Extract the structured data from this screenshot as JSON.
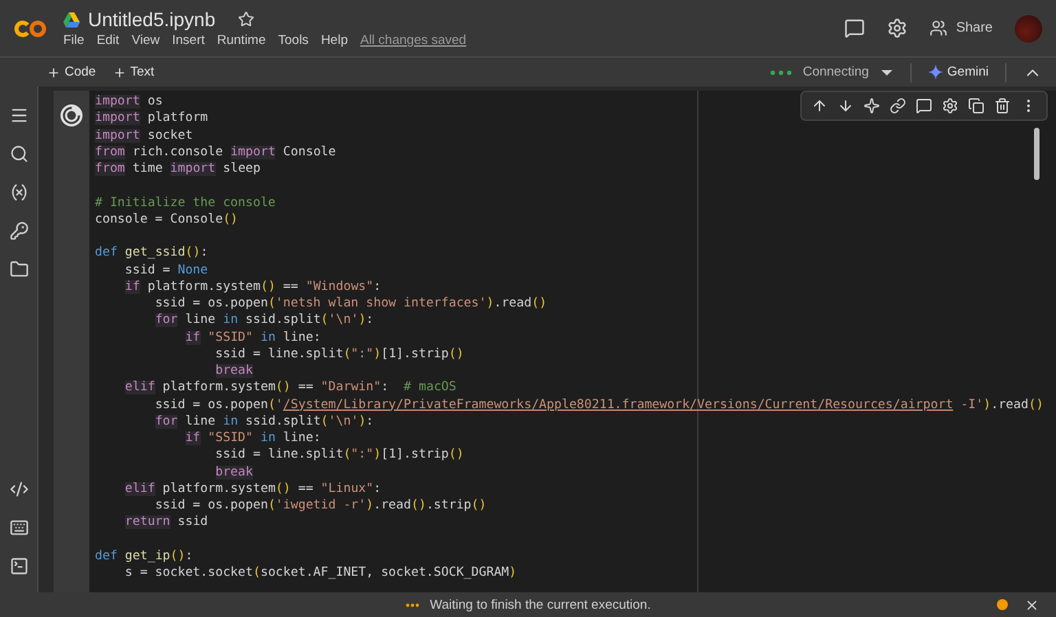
{
  "header": {
    "title": "Untitled5.ipynb",
    "menu": [
      "File",
      "Edit",
      "View",
      "Insert",
      "Runtime",
      "Tools",
      "Help"
    ],
    "save_status": "All changes saved",
    "share": "Share"
  },
  "toolbar": {
    "add_buttons": [
      "Code",
      "Text"
    ],
    "runtime_status": "Connecting",
    "gemini": "Gemini"
  },
  "code_lines": [
    {
      "kind": "code",
      "tokens": [
        {
          "text": "import",
          "kind": "kw"
        },
        {
          "text": " os",
          "kind": "p"
        }
      ]
    },
    {
      "kind": "code",
      "tokens": [
        {
          "text": "import",
          "kind": "kw"
        },
        {
          "text": " platform",
          "kind": "p"
        }
      ]
    },
    {
      "kind": "code",
      "tokens": [
        {
          "text": "import",
          "kind": "kw"
        },
        {
          "text": " socket",
          "kind": "p"
        }
      ]
    },
    {
      "kind": "code",
      "tokens": [
        {
          "text": "from",
          "kind": "kw"
        },
        {
          "text": " rich.console",
          "kind": "p"
        },
        {
          "text": " import",
          "kind": "kw"
        },
        {
          "text": " Console",
          "kind": "p"
        }
      ]
    },
    {
      "kind": "code",
      "tokens": [
        {
          "text": "from",
          "kind": "kw"
        },
        {
          "text": " time",
          "kind": "p"
        },
        {
          "text": " import",
          "kind": "kw"
        },
        {
          "text": " sleep",
          "kind": "p"
        }
      ]
    },
    {
      "kind": "blank"
    },
    {
      "kind": "code",
      "tokens": [
        {
          "text": "# Initialize the console",
          "kind": "cmt"
        }
      ]
    },
    {
      "kind": "code",
      "tokens": [
        {
          "text": "console = Console",
          "kind": "p"
        },
        {
          "text": "()",
          "kind": "par"
        }
      ]
    },
    {
      "kind": "blank"
    },
    {
      "kind": "code",
      "tokens": [
        {
          "text": "def",
          "kind": "kw2"
        },
        {
          "text": " get_ssid",
          "kind": "fn"
        },
        {
          "text": "()",
          "kind": "par"
        },
        {
          "text": ":",
          "kind": "p"
        }
      ]
    },
    {
      "kind": "code",
      "tokens": [
        {
          "text": "    ssid = ",
          "kind": "p"
        },
        {
          "text": "None",
          "kind": "kw2"
        }
      ]
    },
    {
      "kind": "code",
      "tokens": [
        {
          "text": "    if",
          "kind": "kw"
        },
        {
          "text": " platform.system",
          "kind": "p"
        },
        {
          "text": "()",
          "kind": "par"
        },
        {
          "text": " == ",
          "kind": "p"
        },
        {
          "text": "\"Windows\"",
          "kind": "str"
        },
        {
          "text": ":",
          "kind": "p"
        }
      ]
    },
    {
      "kind": "code",
      "tokens": [
        {
          "text": "        ssid = os.popen",
          "kind": "p"
        },
        {
          "text": "(",
          "kind": "par"
        },
        {
          "text": "'netsh wlan show interfaces'",
          "kind": "str"
        },
        {
          "text": ")",
          "kind": "par"
        },
        {
          "text": ".read",
          "kind": "p"
        },
        {
          "text": "()",
          "kind": "par"
        }
      ]
    },
    {
      "kind": "code",
      "tokens": [
        {
          "text": "        for",
          "kind": "kw"
        },
        {
          "text": " line ",
          "kind": "p"
        },
        {
          "text": "in",
          "kind": "kw2"
        },
        {
          "text": " ssid.split",
          "kind": "p"
        },
        {
          "text": "(",
          "kind": "par"
        },
        {
          "text": "'\\n'",
          "kind": "str"
        },
        {
          "text": ")",
          "kind": "par"
        },
        {
          "text": ":",
          "kind": "p"
        }
      ]
    },
    {
      "kind": "code",
      "tokens": [
        {
          "text": "            if",
          "kind": "kw"
        },
        {
          "text": " \"SSID\"",
          "kind": "str"
        },
        {
          "text": " in",
          "kind": "kw2"
        },
        {
          "text": " line:",
          "kind": "p"
        }
      ]
    },
    {
      "kind": "code",
      "tokens": [
        {
          "text": "                ssid = line.split",
          "kind": "p"
        },
        {
          "text": "(",
          "kind": "par"
        },
        {
          "text": "\":\"",
          "kind": "str"
        },
        {
          "text": ")",
          "kind": "par"
        },
        {
          "text": "[1].strip",
          "kind": "p"
        },
        {
          "text": "()",
          "kind": "par"
        }
      ]
    },
    {
      "kind": "code",
      "tokens": [
        {
          "text": "                break",
          "kind": "kw"
        }
      ]
    },
    {
      "kind": "code",
      "tokens": [
        {
          "text": "    elif",
          "kind": "kw"
        },
        {
          "text": " platform.system",
          "kind": "p"
        },
        {
          "text": "()",
          "kind": "par"
        },
        {
          "text": " == ",
          "kind": "p"
        },
        {
          "text": "\"Darwin\"",
          "kind": "str"
        },
        {
          "text": ":",
          "kind": "p"
        },
        {
          "text": "  # macOS",
          "kind": "cmt"
        }
      ]
    },
    {
      "kind": "code",
      "tokens": [
        {
          "text": "        ssid = os.popen",
          "kind": "p"
        },
        {
          "text": "(",
          "kind": "par"
        },
        {
          "text": "'",
          "kind": "str"
        },
        {
          "text": "/System/Library/PrivateFrameworks/Apple80211.framework/Versions/Current/Resources/airport",
          "kind": "url"
        },
        {
          "text": " -I'",
          "kind": "str"
        },
        {
          "text": ")",
          "kind": "par"
        },
        {
          "text": ".read",
          "kind": "p"
        },
        {
          "text": "()",
          "kind": "par"
        }
      ]
    },
    {
      "kind": "code",
      "tokens": [
        {
          "text": "        for",
          "kind": "kw"
        },
        {
          "text": " line ",
          "kind": "p"
        },
        {
          "text": "in",
          "kind": "kw2"
        },
        {
          "text": " ssid.split",
          "kind": "p"
        },
        {
          "text": "(",
          "kind": "par"
        },
        {
          "text": "'\\n'",
          "kind": "str"
        },
        {
          "text": ")",
          "kind": "par"
        },
        {
          "text": ":",
          "kind": "p"
        }
      ]
    },
    {
      "kind": "code",
      "tokens": [
        {
          "text": "            if",
          "kind": "kw"
        },
        {
          "text": " \"SSID\"",
          "kind": "str"
        },
        {
          "text": " in",
          "kind": "kw2"
        },
        {
          "text": " line:",
          "kind": "p"
        }
      ]
    },
    {
      "kind": "code",
      "tokens": [
        {
          "text": "                ssid = line.split",
          "kind": "p"
        },
        {
          "text": "(",
          "kind": "par"
        },
        {
          "text": "\":\"",
          "kind": "str"
        },
        {
          "text": ")",
          "kind": "par"
        },
        {
          "text": "[1].strip",
          "kind": "p"
        },
        {
          "text": "()",
          "kind": "par"
        }
      ]
    },
    {
      "kind": "code",
      "tokens": [
        {
          "text": "                break",
          "kind": "kw"
        }
      ]
    },
    {
      "kind": "code",
      "tokens": [
        {
          "text": "    elif",
          "kind": "kw"
        },
        {
          "text": " platform.system",
          "kind": "p"
        },
        {
          "text": "()",
          "kind": "par"
        },
        {
          "text": " == ",
          "kind": "p"
        },
        {
          "text": "\"Linux\"",
          "kind": "str"
        },
        {
          "text": ":",
          "kind": "p"
        }
      ]
    },
    {
      "kind": "code",
      "tokens": [
        {
          "text": "        ssid = os.popen",
          "kind": "p"
        },
        {
          "text": "(",
          "kind": "par"
        },
        {
          "text": "'iwgetid -r'",
          "kind": "str"
        },
        {
          "text": ")",
          "kind": "par"
        },
        {
          "text": ".read",
          "kind": "p"
        },
        {
          "text": "()",
          "kind": "par"
        },
        {
          "text": ".strip",
          "kind": "p"
        },
        {
          "text": "()",
          "kind": "par"
        }
      ]
    },
    {
      "kind": "code",
      "tokens": [
        {
          "text": "    return",
          "kind": "kw"
        },
        {
          "text": " ssid",
          "kind": "p"
        }
      ]
    },
    {
      "kind": "blank"
    },
    {
      "kind": "code",
      "tokens": [
        {
          "text": "def",
          "kind": "kw2"
        },
        {
          "text": " get_ip",
          "kind": "fn"
        },
        {
          "text": "()",
          "kind": "par"
        },
        {
          "text": ":",
          "kind": "p"
        }
      ]
    },
    {
      "kind": "code",
      "tokens": [
        {
          "text": "    s = socket.socket",
          "kind": "p"
        },
        {
          "text": "(",
          "kind": "par"
        },
        {
          "text": "socket.AF_INET, socket.SOCK_DGRAM",
          "kind": "p"
        },
        {
          "text": ")",
          "kind": "par"
        }
      ]
    }
  ],
  "status_bar": {
    "message": "Waiting to finish the current execution."
  }
}
